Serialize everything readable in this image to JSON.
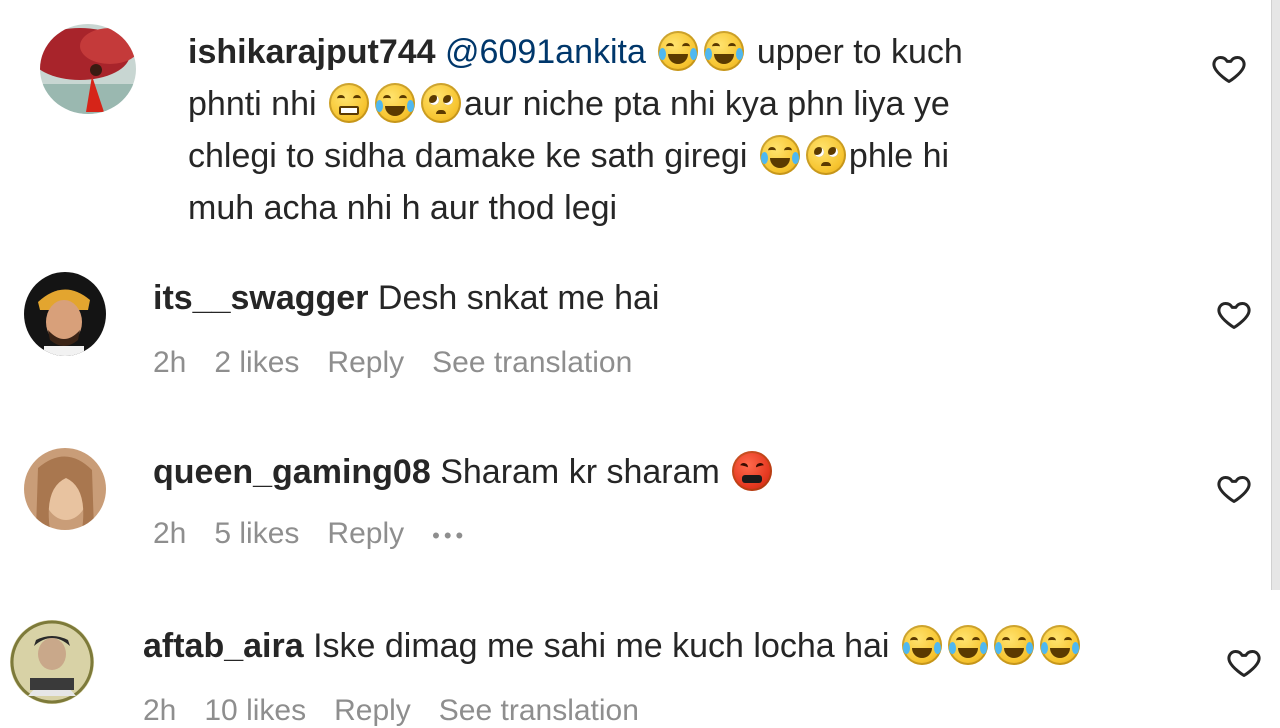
{
  "comments": [
    {
      "username": "ishikarajput744",
      "mention": "@6091ankita",
      "lines": [
        {
          "a": "upper to kuch"
        },
        {
          "a": "phnti nhi",
          "b": "aur niche pta nhi kya phn liya ye"
        },
        {
          "a": "chlegi to sidha damake ke sath giregi",
          "b": "phle hi"
        },
        {
          "a": "muh acha nhi h aur thod legi"
        }
      ]
    },
    {
      "username": "its__swagger",
      "text": "Desh snkat me hai",
      "time": "2h",
      "likes": "2 likes",
      "reply": "Reply",
      "translate": "See translation"
    },
    {
      "username": "queen_gaming08",
      "text": "Sharam kr sharam",
      "time": "2h",
      "likes": "5 likes",
      "reply": "Reply",
      "more": "•••"
    },
    {
      "username": "aftab_aira",
      "text": "Iske dimag me sahi me kuch locha hai",
      "time": "2h",
      "likes": "10 likes",
      "reply": "Reply",
      "translate": "See translation"
    }
  ],
  "icons": {
    "like": "heart-icon",
    "more": "more-options-icon",
    "emoji_laugh": "face-with-tears-of-joy",
    "emoji_pleading": "pleading-face",
    "emoji_grit": "grimacing-face",
    "emoji_angry": "face-with-symbols-on-mouth"
  },
  "colors": {
    "text": "#262626",
    "mention": "#00376b",
    "meta": "#8e8e8e"
  }
}
